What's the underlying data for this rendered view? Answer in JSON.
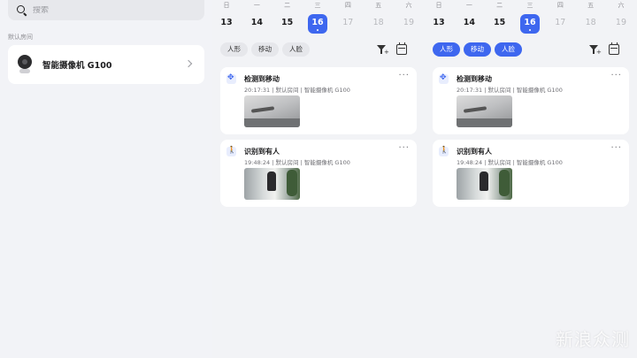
{
  "search": {
    "placeholder": "搜索"
  },
  "room": {
    "label": "默认房间"
  },
  "device": {
    "name": "智能摄像机 G100"
  },
  "calendar": {
    "weekdays": [
      "日",
      "一",
      "二",
      "三",
      "四",
      "五",
      "六"
    ],
    "dates": [
      "13",
      "14",
      "15",
      "16",
      "17",
      "18",
      "19"
    ],
    "selected_date": "16"
  },
  "filters": {
    "humanoid": "人形",
    "motion": "移动",
    "face": "人脸"
  },
  "events": [
    {
      "title": "检测到移动",
      "meta": "20:17:31 | 默认房间 | 智能摄像机 G100",
      "icon": "motion-icon"
    },
    {
      "title": "识别到有人",
      "meta": "19:48:24 | 默认房间 | 智能摄像机 G100",
      "icon": "person-walking-icon"
    }
  ],
  "panels": [
    {
      "active_filters": []
    },
    {
      "active_filters": [
        "humanoid",
        "motion",
        "face"
      ]
    }
  ],
  "more_label": "···",
  "watermark": "新浪众测",
  "colors": {
    "accent": "#3e67ef",
    "background": "#f2f3f6",
    "card": "#ffffff"
  }
}
